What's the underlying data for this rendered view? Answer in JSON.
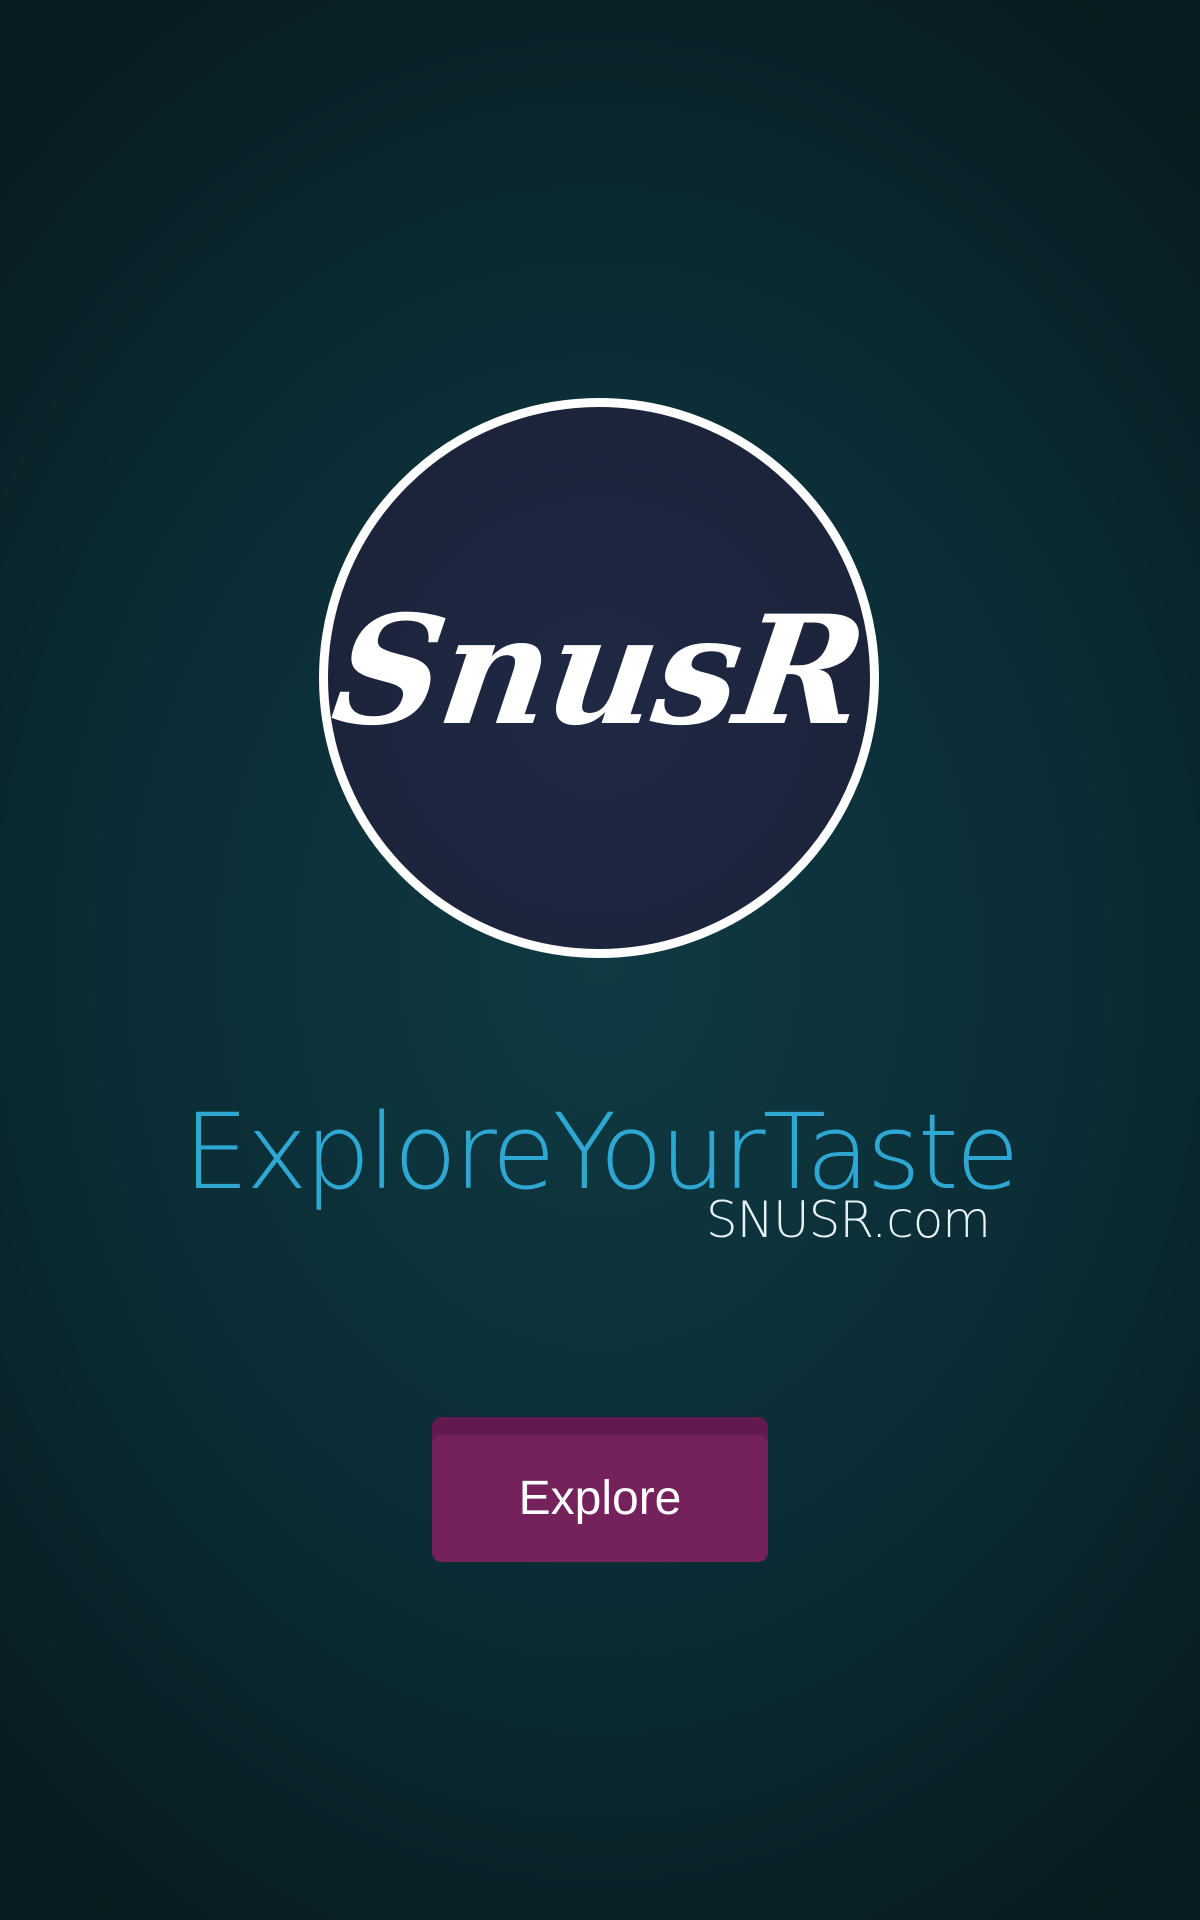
{
  "logo": {
    "text": "SnusR"
  },
  "tagline": "ExploreYourTaste",
  "domain": "SNUSR.com",
  "explore_button": {
    "label": "Explore"
  },
  "colors": {
    "background": "#0b2c34",
    "logo_circle": "#1b2238",
    "logo_border": "#ffffff",
    "tagline": "#2fa7d3",
    "button": "#74215c"
  }
}
